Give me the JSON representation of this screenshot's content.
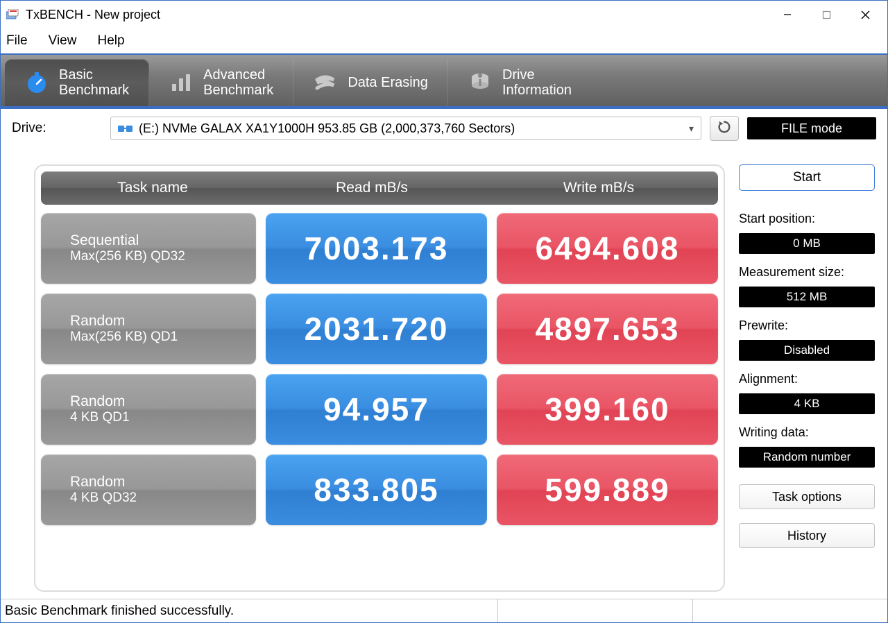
{
  "window": {
    "title": "TxBENCH - New project"
  },
  "menu": {
    "file": "File",
    "view": "View",
    "help": "Help"
  },
  "tabs": {
    "basic": {
      "line1": "Basic",
      "line2": "Benchmark"
    },
    "advanced": {
      "line1": "Advanced",
      "line2": "Benchmark"
    },
    "erasing": {
      "line1": "Data Erasing"
    },
    "driveinfo": {
      "line1": "Drive",
      "line2": "Information"
    }
  },
  "drive": {
    "label": "Drive:",
    "selected": "(E:) NVMe GALAX XA1Y1000H  953.85 GB (2,000,373,760 Sectors)",
    "filemode": "FILE mode"
  },
  "headers": {
    "task": "Task name",
    "read": "Read mB/s",
    "write": "Write mB/s"
  },
  "rows": [
    {
      "title": "Sequential",
      "sub": "Max(256 KB) QD32",
      "read": "7003.173",
      "write": "6494.608"
    },
    {
      "title": "Random",
      "sub": "Max(256 KB) QD1",
      "read": "2031.720",
      "write": "4897.653"
    },
    {
      "title": "Random",
      "sub": "4 KB QD1",
      "read": "94.957",
      "write": "399.160"
    },
    {
      "title": "Random",
      "sub": "4 KB QD32",
      "read": "833.805",
      "write": "599.889"
    }
  ],
  "side": {
    "start": "Start",
    "startpos_label": "Start position:",
    "startpos_value": "0 MB",
    "msize_label": "Measurement size:",
    "msize_value": "512 MB",
    "prewrite_label": "Prewrite:",
    "prewrite_value": "Disabled",
    "align_label": "Alignment:",
    "align_value": "4 KB",
    "wdata_label": "Writing data:",
    "wdata_value": "Random number",
    "task_options": "Task options",
    "history": "History"
  },
  "status": "Basic Benchmark finished successfully."
}
